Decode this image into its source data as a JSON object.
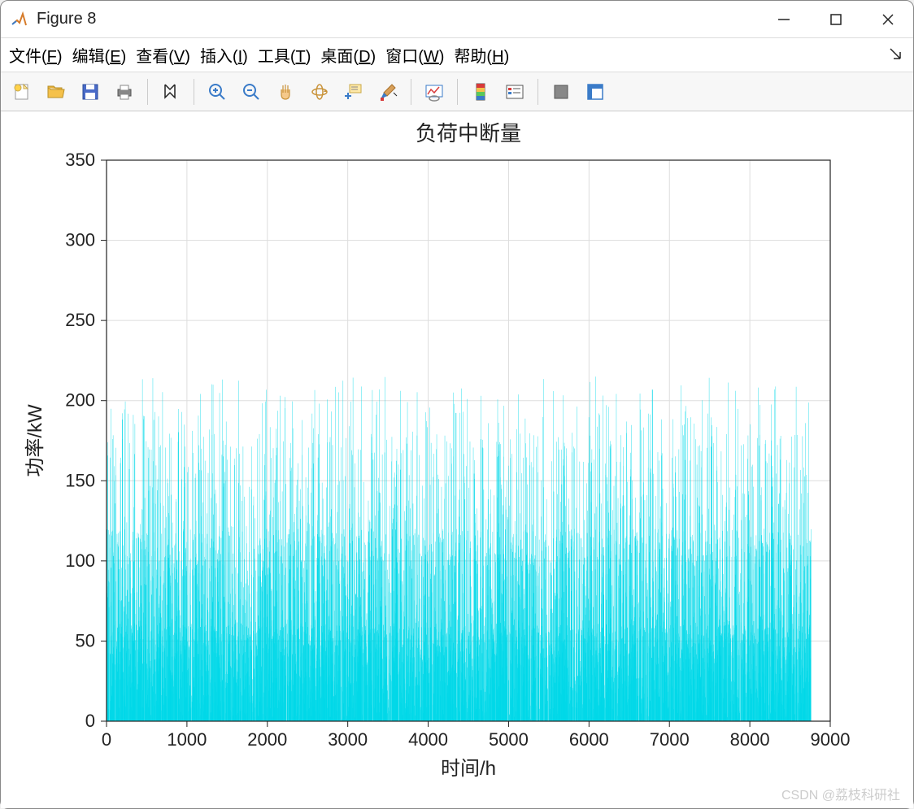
{
  "window": {
    "title": "Figure 8"
  },
  "menubar": {
    "items": [
      {
        "label": "文件",
        "key": "F"
      },
      {
        "label": "编辑",
        "key": "E"
      },
      {
        "label": "查看",
        "key": "V"
      },
      {
        "label": "插入",
        "key": "I"
      },
      {
        "label": "工具",
        "key": "T"
      },
      {
        "label": "桌面",
        "key": "D"
      },
      {
        "label": "窗口",
        "key": "W"
      },
      {
        "label": "帮助",
        "key": "H"
      }
    ]
  },
  "toolbar": {
    "buttons": [
      {
        "name": "new-figure-icon"
      },
      {
        "name": "open-icon"
      },
      {
        "name": "save-icon"
      },
      {
        "name": "print-icon"
      },
      {
        "sep": true
      },
      {
        "name": "edit-plot-icon"
      },
      {
        "sep": true
      },
      {
        "name": "zoom-in-icon"
      },
      {
        "name": "zoom-out-icon"
      },
      {
        "name": "pan-icon"
      },
      {
        "name": "rotate-3d-icon"
      },
      {
        "name": "data-cursor-icon"
      },
      {
        "name": "brush-icon"
      },
      {
        "sep": true
      },
      {
        "name": "link-plot-icon"
      },
      {
        "sep": true
      },
      {
        "name": "colorbar-icon"
      },
      {
        "name": "legend-icon"
      },
      {
        "sep": true
      },
      {
        "name": "hide-tools-icon"
      },
      {
        "name": "show-tools-icon"
      }
    ]
  },
  "watermark": "CSDN @荔枝科研社",
  "chart_data": {
    "type": "bar",
    "title": "负荷中断量",
    "xlabel": "时间/h",
    "ylabel": "功率/kW",
    "xlim": [
      0,
      9000
    ],
    "ylim": [
      0,
      350
    ],
    "xticks": [
      0,
      1000,
      2000,
      3000,
      4000,
      5000,
      6000,
      7000,
      8000,
      9000
    ],
    "yticks": [
      0,
      50,
      100,
      150,
      200,
      250,
      300,
      350
    ],
    "color": "#00D8E8",
    "n_points": 8760,
    "note": "Dense hourly series ~8760 bars; individual values not legible — distribution: most 0‑150, peaks ≈200‑215.",
    "seed_for_visual": 42
  }
}
